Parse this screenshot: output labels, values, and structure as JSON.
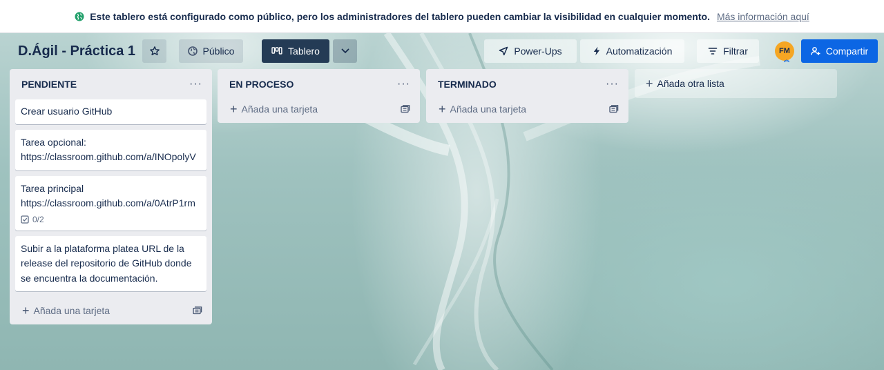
{
  "banner": {
    "message": "Este tablero está configurado como público, pero los administradores del tablero pueden cambiar la visibilidad en cualquier momento.",
    "link": "Más información aquí",
    "icon": "globe-icon"
  },
  "header": {
    "title": "D.Ágil - Práctica 1",
    "visibility_label": "Público",
    "view_label": "Tablero",
    "powerups_label": "Power-Ups",
    "automation_label": "Automatización",
    "filter_label": "Filtrar",
    "avatar_initials": "FM",
    "share_label": "Compartir",
    "accent_color": "#0c66e4",
    "avatar_color": "#f5a623"
  },
  "lists": [
    {
      "title": "PENDIENTE",
      "cards": [
        {
          "text": "Crear usuario GitHub"
        },
        {
          "text": "Tarea opcional: https://classroom.github.com/a/INOpolyV"
        },
        {
          "text": "Tarea principal https://classroom.github.com/a/0AtrP1rm",
          "checklist": "0/2"
        },
        {
          "text": "Subir a la plataforma platea URL de la release del repositorio de GitHub donde se encuentra la documentación."
        }
      ],
      "add_card_label": "Añada una tarjeta"
    },
    {
      "title": "EN PROCESO",
      "cards": [],
      "add_card_label": "Añada una tarjeta"
    },
    {
      "title": "TERMINADO",
      "cards": [],
      "add_card_label": "Añada una tarjeta"
    }
  ],
  "add_list_label": "Añada otra lista"
}
